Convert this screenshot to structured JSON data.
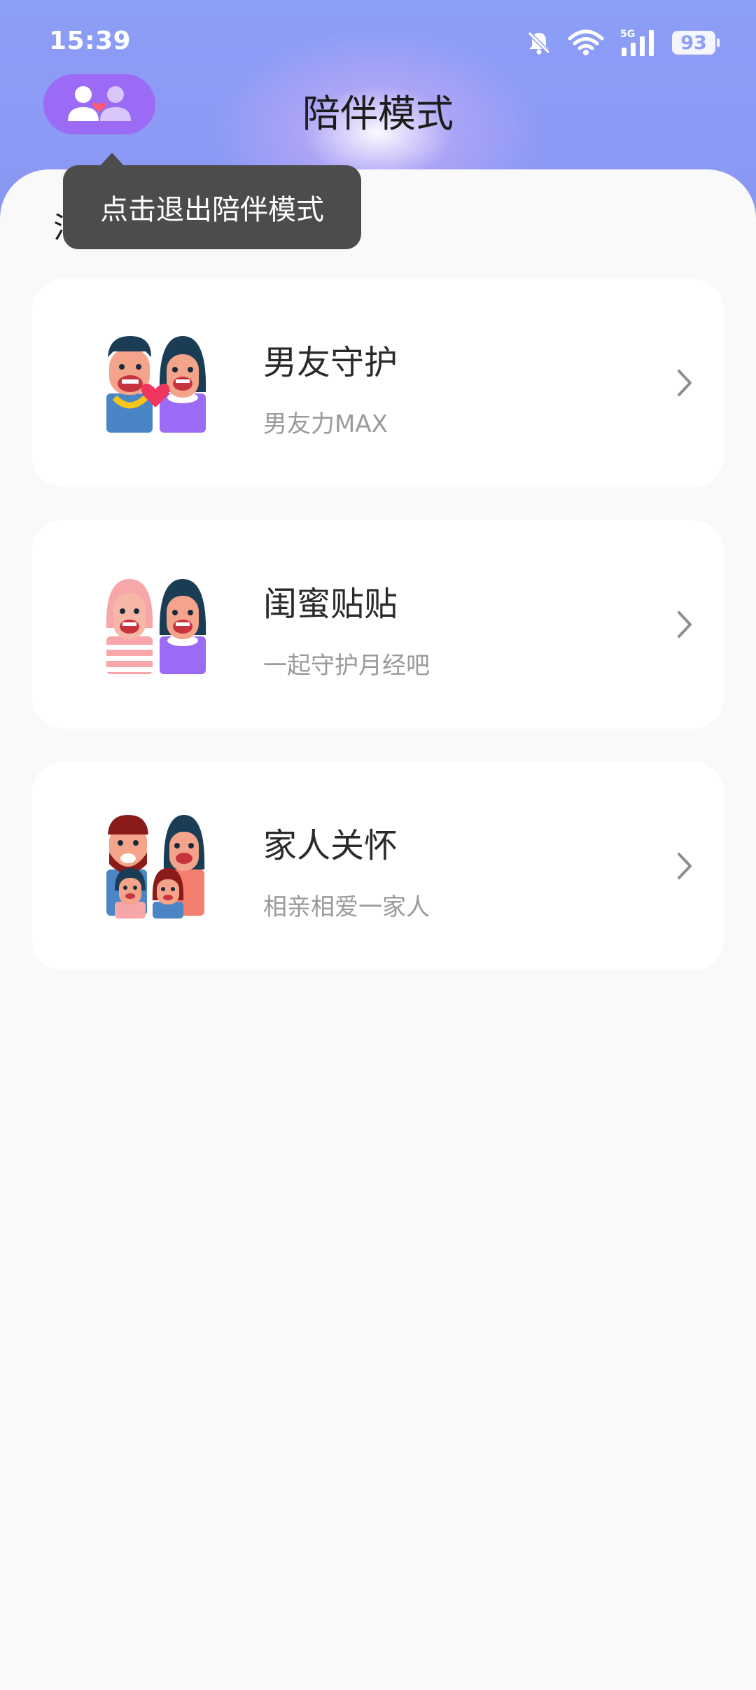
{
  "status_bar": {
    "time": "15:39",
    "network": "5G",
    "battery": "93",
    "icons": [
      "bell-muted-icon",
      "wifi-icon",
      "signal-icon",
      "battery-icon"
    ]
  },
  "header": {
    "title": "陪伴模式",
    "toggle_icon": "couple-heart-icon"
  },
  "tooltip": {
    "text": "点击退出陪伴模式"
  },
  "section": {
    "title_fragment": "泪"
  },
  "cards": [
    {
      "title": "男友守护",
      "subtitle": "男友力MAX",
      "icon": "couple-avatar-icon"
    },
    {
      "title": "闺蜜贴贴",
      "subtitle": "一起守护月经吧",
      "icon": "bestie-avatar-icon"
    },
    {
      "title": "家人关怀",
      "subtitle": "相亲相爱一家人",
      "icon": "family-avatar-icon"
    }
  ],
  "colors": {
    "header": "#8d9ef6",
    "accent": "#9b6bf6",
    "tooltip": "#4c4c4c",
    "background": "#f9f9f9",
    "card": "#ffffff"
  }
}
